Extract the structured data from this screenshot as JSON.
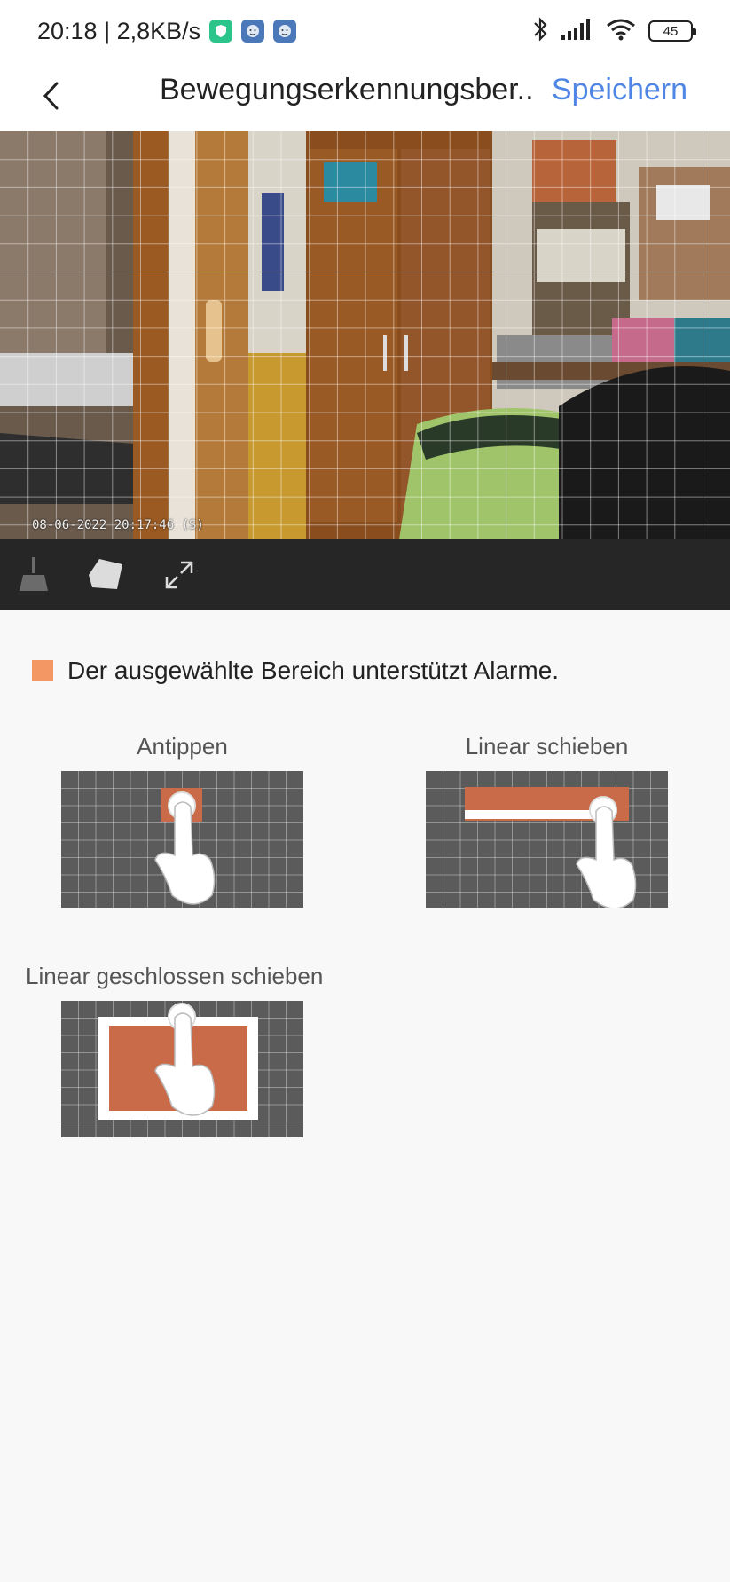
{
  "status_bar": {
    "time_speed": "20:18 | 2,8KB/s",
    "battery": "45",
    "icons": [
      "shield-app-icon",
      "face-app-icon",
      "face-app-icon",
      "bluetooth-icon",
      "signal-icon",
      "wifi-icon",
      "battery-icon"
    ]
  },
  "header": {
    "back_icon": "chevron-left-icon",
    "title": "Bewegungserkennungsber..",
    "save_label": "Speichern"
  },
  "camera": {
    "timestamp": "08-06-2022 20:17:46  (S)"
  },
  "toolbar": {
    "tools": [
      "broom-icon",
      "eraser-icon",
      "expand-icon"
    ]
  },
  "legend": {
    "swatch_color": "#f39765",
    "text": "Der ausgewählte Bereich unterstützt Alarme."
  },
  "demos": [
    {
      "label": "Antippen"
    },
    {
      "label": "Linear schieben"
    },
    {
      "label": "Linear geschlossen schieben"
    }
  ],
  "colors": {
    "accent": "#4f86e6",
    "selection": "#c96a48",
    "tile_bg": "#5b5b5b"
  }
}
